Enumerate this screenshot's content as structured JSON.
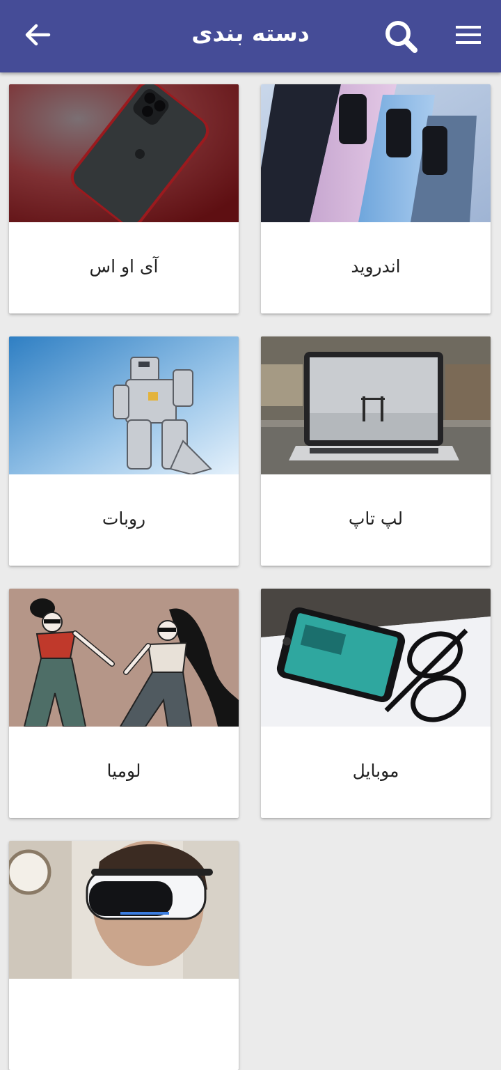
{
  "header": {
    "title": "دسته بندی",
    "back_icon": "arrow-left-icon",
    "search_icon": "search-icon",
    "menu_icon": "hamburger-menu-icon",
    "background": "#454c97"
  },
  "categories": [
    {
      "label": "اندروید",
      "image": "android-phones-photo"
    },
    {
      "label": "آی او اس",
      "image": "iphone-photo"
    },
    {
      "label": "لپ تاپ",
      "image": "laptop-photo"
    },
    {
      "label": "روبات",
      "image": "robot-photo"
    },
    {
      "label": "موبایل",
      "image": "mobile-photo"
    },
    {
      "label": "لومیا",
      "image": "lumia-illustration"
    },
    {
      "label": "",
      "image": "vr-headset-photo"
    }
  ]
}
